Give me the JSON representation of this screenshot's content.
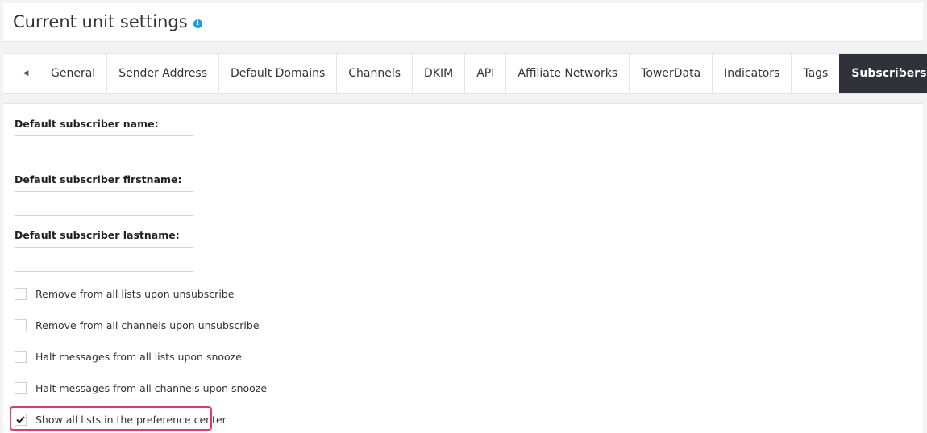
{
  "header": {
    "title": "Current unit settings",
    "info_icon": "info-icon"
  },
  "tabs": {
    "prev_icon": "triangle-left-icon",
    "next_icon": "triangle-right-icon",
    "items": [
      {
        "label": "General",
        "active": false
      },
      {
        "label": "Sender Address",
        "active": false
      },
      {
        "label": "Default Domains",
        "active": false
      },
      {
        "label": "Channels",
        "active": false
      },
      {
        "label": "DKIM",
        "active": false
      },
      {
        "label": "API",
        "active": false
      },
      {
        "label": "Affiliate Networks",
        "active": false
      },
      {
        "label": "TowerData",
        "active": false
      },
      {
        "label": "Indicators",
        "active": false
      },
      {
        "label": "Tags",
        "active": false
      },
      {
        "label": "Subscribers",
        "active": true
      }
    ]
  },
  "form": {
    "fields": [
      {
        "label": "Default subscriber name:",
        "value": ""
      },
      {
        "label": "Default subscriber firstname:",
        "value": ""
      },
      {
        "label": "Default subscriber lastname:",
        "value": ""
      }
    ],
    "checkboxes": [
      {
        "label": "Remove from all lists upon unsubscribe",
        "checked": false
      },
      {
        "label": "Remove from all channels upon unsubscribe",
        "checked": false
      },
      {
        "label": "Halt messages from all lists upon snooze",
        "checked": false
      },
      {
        "label": "Halt messages from all channels upon snooze",
        "checked": false
      },
      {
        "label": "Show all lists in the preference center",
        "checked": true
      }
    ]
  },
  "colors": {
    "active_tab_bg": "#2f3239",
    "info_icon": "#1e9fd8",
    "highlight": "#e23a6a"
  }
}
